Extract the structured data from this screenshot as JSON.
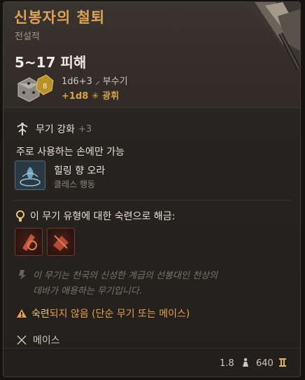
{
  "item": {
    "name": "신봉자의 철퇴",
    "rarity": "전설적",
    "damage_range": "5~17 피해",
    "damage_base": "1d6+3",
    "damage_base_type": "부수기",
    "damage_bonus": "+1d8",
    "damage_bonus_type": "광휘"
  },
  "enchant": {
    "label": "무기 강화",
    "value": "+3"
  },
  "restriction": "주로 사용하는 손에만 가능",
  "action": {
    "name": "힐링 향 오라",
    "type": "클레스 행동"
  },
  "mastery": {
    "label": "이 무기 유형에 대한 숙련으로 해금:"
  },
  "flavor_lines": [
    "이 무기는 천국의 신성한 계급의 선봉대인 천상의",
    "데바가 애용하는 무기입니다."
  ],
  "warning": {
    "part_a": "숙련",
    "part_b": "되지 않음 (단순 무기 또는 메이스)"
  },
  "weapon_type": "메이스",
  "footer": {
    "weight": "1.8",
    "price": "640"
  },
  "colors": {
    "title": "#e0a256",
    "radiant": "#d9a24a",
    "warning": "#e6a14a"
  },
  "icons": [
    "dice-icon",
    "bludgeon-icon",
    "sparkle-icon",
    "enchant-icon",
    "healing-aura-icon",
    "mastery-icon",
    "info-icon",
    "warning-icon",
    "mace-icon",
    "weight-icon",
    "coin-icon"
  ]
}
